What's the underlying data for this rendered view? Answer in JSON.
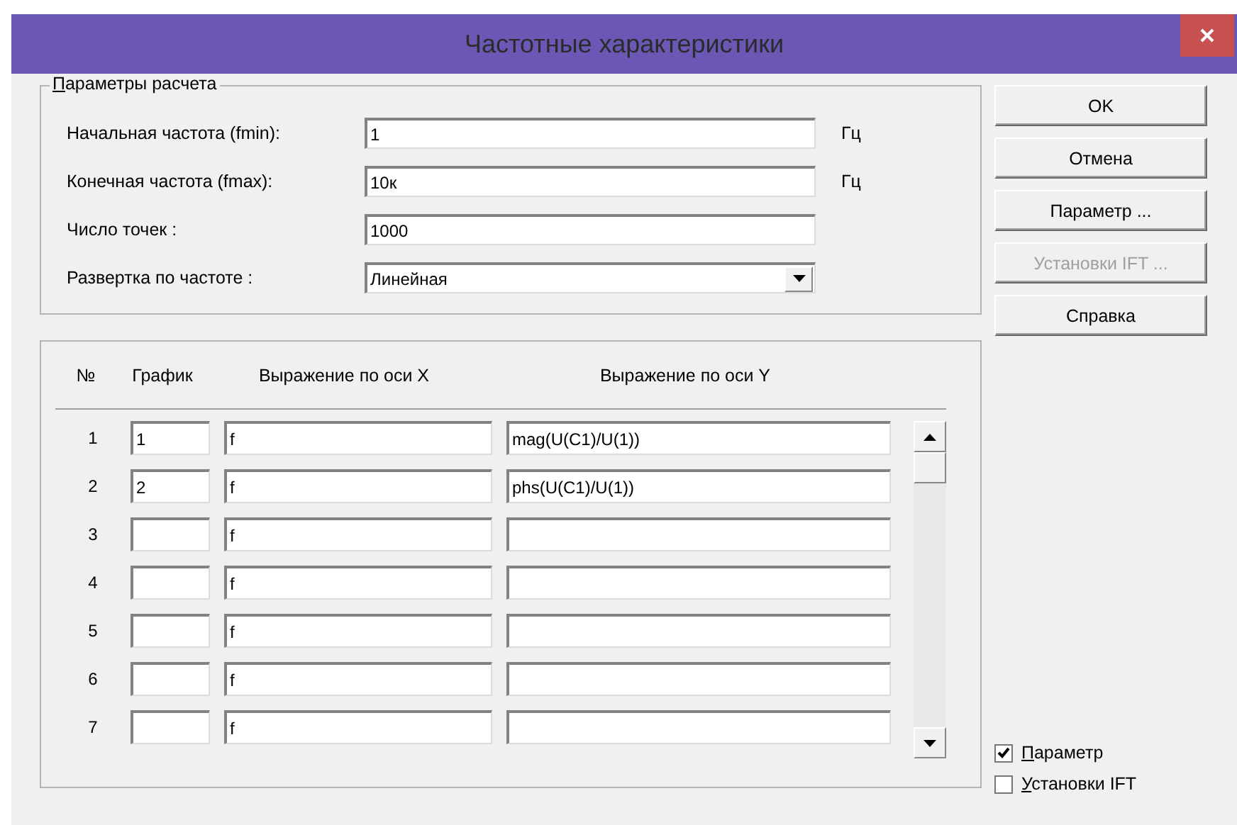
{
  "window": {
    "title": "Частотные характеристики"
  },
  "params": {
    "title": "Параметры расчета",
    "fields": [
      {
        "label": "Начальная частота (fmin):",
        "kind": "text",
        "value": "1",
        "unit": "Гц"
      },
      {
        "label": "Конечная частота (fmax):",
        "kind": "text",
        "value": "10к",
        "unit": "Гц"
      },
      {
        "label": "Число точек :",
        "kind": "text",
        "value": "1000"
      },
      {
        "label": "Развертка по частоте :",
        "kind": "select",
        "value": "Линейная"
      }
    ]
  },
  "buttons": [
    {
      "label": "OK",
      "disabled": false
    },
    {
      "label": "Отмена",
      "disabled": false
    },
    {
      "label": "Параметр ...",
      "disabled": false
    },
    {
      "label": "Установки IFT ...",
      "disabled": true
    },
    {
      "label": "Справка",
      "disabled": false
    }
  ],
  "table": {
    "columns": [
      "№",
      "График",
      "Выражение по оси X",
      "Выражение по оси Y"
    ],
    "rows": [
      {
        "n": "1",
        "plot": "1",
        "x": "f",
        "y": "mag(U(C1)/U(1))"
      },
      {
        "n": "2",
        "plot": "2",
        "x": "f",
        "y": "phs(U(C1)/U(1))"
      },
      {
        "n": "3",
        "x": "f"
      },
      {
        "n": "4",
        "x": "f"
      },
      {
        "n": "5",
        "x": "f"
      },
      {
        "n": "6",
        "x": "f"
      },
      {
        "n": "7",
        "x": "f"
      }
    ]
  },
  "checkboxes": [
    {
      "label": "Параметр",
      "checked": true
    },
    {
      "label": "Установки IFT",
      "checked": false
    }
  ]
}
